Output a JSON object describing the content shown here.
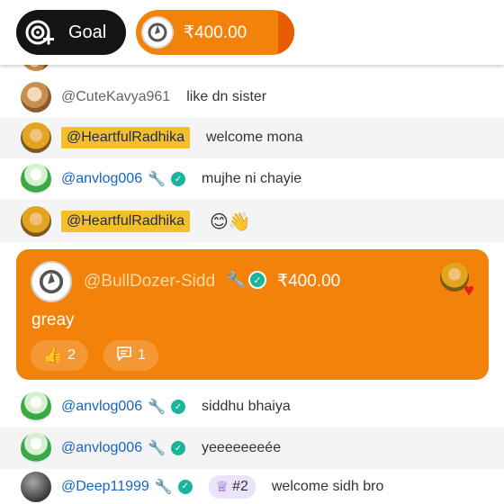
{
  "header": {
    "goal_label": "Goal",
    "amount_label": "₹400.00"
  },
  "colors": {
    "accent": "#f2820a",
    "goal_bg": "#141414",
    "highlight": "#f5bf2b",
    "mention_blue": "#1565c0"
  },
  "messages_top": [
    {
      "username": "@CuteKavya961",
      "text": "like dn sister"
    },
    {
      "username": "@HeartfulRadhika",
      "text": "welcome mona"
    },
    {
      "username": "@anvlog006",
      "text": "mujhe ni chayie"
    },
    {
      "username": "@HeartfulRadhika",
      "text": "😊👋"
    }
  ],
  "super_chat": {
    "username": "@BullDozer-Sidd",
    "amount": "₹400.00",
    "text": "greay",
    "likes": "2",
    "comments": "1"
  },
  "messages_bottom": [
    {
      "username": "@anvlog006",
      "text": "siddhu bhaiya"
    },
    {
      "username": "@anvlog006",
      "text": "yeeeeeeeée"
    },
    {
      "username": "@Deep11999",
      "rank": "#2",
      "text": "welcome sidh bro"
    }
  ]
}
